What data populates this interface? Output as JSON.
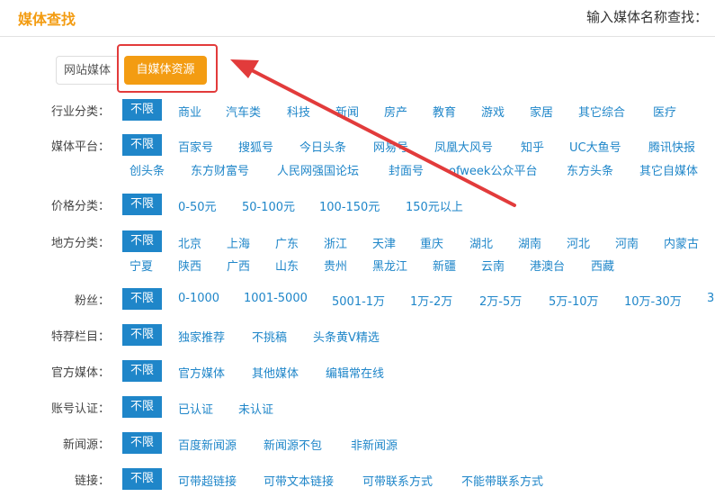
{
  "header": {
    "title": "媒体查找",
    "search_hint": "输入媒体名称查找："
  },
  "tabs": {
    "web": "网站媒体",
    "self": "自媒体资源"
  },
  "badge": "不限",
  "filters": [
    {
      "label": "行业分类：",
      "options": [
        "商业",
        "汽车类",
        "科技",
        "新闻",
        "房产",
        "教育",
        "游戏",
        "家居",
        "其它综合",
        "医疗"
      ]
    },
    {
      "label": "媒体平台：",
      "options": [
        "百家号",
        "搜狐号",
        "今日头条",
        "网易号",
        "凤凰大风号",
        "知乎",
        "UC大鱼号",
        "腾讯快报"
      ],
      "options2": [
        "创头条",
        "东方财富号",
        "人民网强国论坛",
        "封面号",
        "ofweek公众平台",
        "东方头条",
        "其它自媒体"
      ]
    },
    {
      "label": "价格分类：",
      "options": [
        "0-50元",
        "50-100元",
        "100-150元",
        "150元以上"
      ]
    },
    {
      "label": "地方分类：",
      "options": [
        "北京",
        "上海",
        "广东",
        "浙江",
        "天津",
        "重庆",
        "湖北",
        "湖南",
        "河北",
        "河南",
        "内蒙古"
      ],
      "options2": [
        "宁夏",
        "陕西",
        "广西",
        "山东",
        "贵州",
        "黑龙江",
        "新疆",
        "云南",
        "港澳台",
        "西藏"
      ]
    },
    {
      "label": "粉丝：",
      "options": [
        "0-1000",
        "1001-5000",
        "5001-1万",
        "1万-2万",
        "2万-5万",
        "5万-10万",
        "10万-30万",
        "3"
      ]
    },
    {
      "label": "特荐栏目：",
      "options": [
        "独家推荐",
        "不挑稿",
        "头条黄V精选"
      ]
    },
    {
      "label": "官方媒体：",
      "options": [
        "官方媒体",
        "其他媒体",
        "编辑常在线"
      ]
    },
    {
      "label": "账号认证：",
      "options": [
        "已认证",
        "未认证"
      ]
    },
    {
      "label": "新闻源：",
      "options": [
        "百度新闻源",
        "新闻源不包",
        "非新闻源"
      ]
    },
    {
      "label": "链接：",
      "options": [
        "可带超链接",
        "可带文本链接",
        "可带联系方式",
        "不能带联系方式"
      ]
    }
  ],
  "colors": {
    "accent": "#f39c12",
    "badge": "#1f86c9",
    "option": "#1f86c9",
    "annotation": "#e23b3b"
  }
}
